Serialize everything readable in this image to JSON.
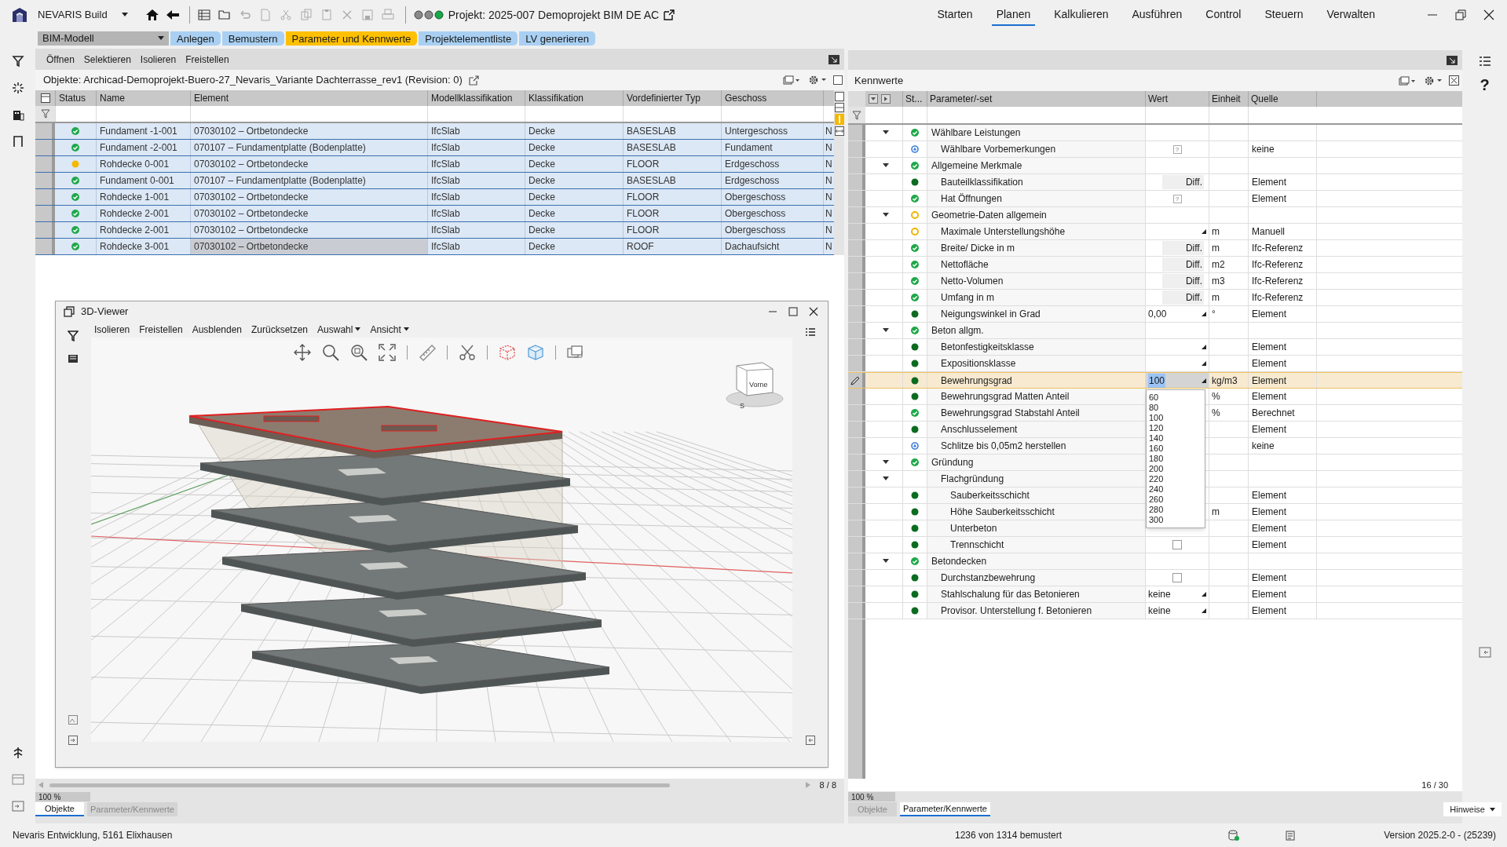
{
  "app": {
    "title": "NEVARIS Build",
    "project": "Projekt: 2025-007 Demoprojekt BIM DE AC"
  },
  "main_menu": [
    {
      "label": "Starten",
      "selected": false
    },
    {
      "label": "Planen",
      "selected": true
    },
    {
      "label": "Kalkulieren",
      "selected": false
    },
    {
      "label": "Ausführen",
      "selected": false
    },
    {
      "label": "Control",
      "selected": false
    },
    {
      "label": "Steuern",
      "selected": false
    },
    {
      "label": "Verwalten",
      "selected": false
    }
  ],
  "module_selector": "BIM-Modell",
  "steps": [
    {
      "label": "Anlegen",
      "selected": false
    },
    {
      "label": "Bemustern",
      "selected": false
    },
    {
      "label": "Parameter und Kennwerte",
      "selected": true
    },
    {
      "label": "Projektelementliste",
      "selected": false
    },
    {
      "label": "LV generieren",
      "selected": false
    }
  ],
  "objects_panel": {
    "toolbar": [
      "Öffnen",
      "Selektieren",
      "Isolieren",
      "Freistellen"
    ],
    "title": "Objekte: Archicad-Demoprojekt-Buero-27_Nevaris_Variante Dachterrasse_rev1 (Revision: 0)",
    "status_header": "Status",
    "columns": [
      "Name",
      "Element",
      "Modellklassifikation",
      "Klassifikation",
      "Vordefinierter Typ",
      "Geschoss"
    ],
    "rows": [
      {
        "status": {
          "kind": "check",
          "color": "#1fa84a"
        },
        "selected": true,
        "focused": false,
        "cells": [
          "Fundament -1-001",
          "07030102 – Ortbetondecke",
          "IfcSlab",
          "Decke",
          "BASESLAB",
          "Untergeschoss",
          "N"
        ]
      },
      {
        "status": {
          "kind": "check",
          "color": "#1fa84a"
        },
        "selected": true,
        "focused": false,
        "cells": [
          "Fundament -2-001",
          "070107 – Fundamentplatte (Bodenplatte)",
          "IfcSlab",
          "Decke",
          "BASESLAB",
          "Fundament",
          "N"
        ]
      },
      {
        "status": {
          "kind": "dot",
          "color": "#f5b800"
        },
        "selected": true,
        "focused": false,
        "cells": [
          "Rohdecke 0-001",
          "07030102 – Ortbetondecke",
          "IfcSlab",
          "Decke",
          "FLOOR",
          "Erdgeschoss",
          "N"
        ]
      },
      {
        "status": {
          "kind": "check",
          "color": "#1fa84a"
        },
        "selected": true,
        "focused": false,
        "cells": [
          "Fundament 0-001",
          "070107 – Fundamentplatte (Bodenplatte)",
          "IfcSlab",
          "Decke",
          "BASESLAB",
          "Erdgeschoss",
          "N"
        ]
      },
      {
        "status": {
          "kind": "check",
          "color": "#1fa84a"
        },
        "selected": true,
        "focused": false,
        "cells": [
          "Rohdecke 1-001",
          "07030102 – Ortbetondecke",
          "IfcSlab",
          "Decke",
          "FLOOR",
          "Obergeschoss",
          "N"
        ]
      },
      {
        "status": {
          "kind": "check",
          "color": "#1fa84a"
        },
        "selected": true,
        "focused": false,
        "cells": [
          "Rohdecke 2-001",
          "07030102 – Ortbetondecke",
          "IfcSlab",
          "Decke",
          "FLOOR",
          "Obergeschoss",
          "N"
        ]
      },
      {
        "status": {
          "kind": "check",
          "color": "#1fa84a"
        },
        "selected": true,
        "focused": false,
        "cells": [
          "Rohdecke 2-001",
          "07030102 – Ortbetondecke",
          "IfcSlab",
          "Decke",
          "FLOOR",
          "Obergeschoss",
          "N"
        ]
      },
      {
        "status": {
          "kind": "check",
          "color": "#1fa84a"
        },
        "selected": true,
        "focused": true,
        "cells": [
          "Rohdecke 3-001",
          "07030102 – Ortbetondecke",
          "IfcSlab",
          "Decke",
          "ROOF",
          "Dachaufsicht",
          "N"
        ]
      }
    ],
    "page": "8 / 8",
    "zoom": "100 %",
    "tabs": [
      {
        "label": "Objekte",
        "selected": true
      },
      {
        "label": "Parameter/Kennwerte",
        "selected": false
      }
    ]
  },
  "viewer": {
    "title": "3D-Viewer",
    "menu": [
      {
        "label": "Isolieren",
        "kind": "item"
      },
      {
        "label": "Freistellen",
        "kind": "item"
      },
      {
        "label": "Ausblenden",
        "kind": "item"
      },
      {
        "label": "Zurücksetzen",
        "kind": "item"
      },
      {
        "label": "Auswahl",
        "kind": "menu"
      },
      {
        "label": "Ansicht",
        "kind": "menu"
      }
    ],
    "cube": {
      "face": "Vorne",
      "compass": "S"
    }
  },
  "kennwerte": {
    "title": "Kennwerte",
    "columns": [
      "St...",
      "Parameter/-set",
      "Wert",
      "Einheit",
      "Quelle"
    ],
    "rows": [
      {
        "label": "Wählbare Leistungen",
        "status": {
          "kind": "check",
          "color": "#1fa84a"
        },
        "expanded": true,
        "selected": false,
        "children": [
          {
            "label": "Wählbare Vorbemerkungen",
            "status": {
              "kind": "ring_triangle",
              "color": "#3b7ddd"
            },
            "selected": false,
            "value": {
              "kind": "flag",
              "text": "?"
            },
            "source": "keine"
          }
        ]
      },
      {
        "label": "Allgemeine Merkmale",
        "status": {
          "kind": "check",
          "color": "#1fa84a"
        },
        "expanded": true,
        "selected": false,
        "children": [
          {
            "label": "Bauteilklassifikation",
            "status": {
              "kind": "dot",
              "color": "#0b6b1f"
            },
            "selected": false,
            "value": {
              "kind": "diff",
              "text": "Diff."
            },
            "source": "Element"
          },
          {
            "label": "Hat Öffnungen",
            "status": {
              "kind": "check",
              "color": "#1fa84a"
            },
            "selected": false,
            "value": {
              "kind": "flag",
              "text": "?"
            },
            "source": "Element"
          }
        ]
      },
      {
        "label": "Geometrie-Daten allgemein",
        "status": {
          "kind": "ring",
          "color": "#f2b400"
        },
        "expanded": true,
        "selected": false,
        "children": [
          {
            "label": "Maximale Unterstellungshöhe",
            "status": {
              "kind": "ring",
              "color": "#f2b400"
            },
            "selected": false,
            "value": {
              "kind": "dropdown"
            },
            "unit": "m",
            "source": "Manuell"
          },
          {
            "label": "Breite/ Dicke in m",
            "status": {
              "kind": "check",
              "color": "#1fa84a"
            },
            "selected": false,
            "value": {
              "kind": "diff",
              "text": "Diff."
            },
            "unit": "m",
            "source": "Ifc-Referenz"
          },
          {
            "label": "Nettofläche",
            "status": {
              "kind": "check",
              "color": "#1fa84a"
            },
            "selected": false,
            "value": {
              "kind": "diff",
              "text": "Diff."
            },
            "unit": "m2",
            "source": "Ifc-Referenz"
          },
          {
            "label": "Netto-Volumen",
            "status": {
              "kind": "check",
              "color": "#1fa84a"
            },
            "selected": false,
            "value": {
              "kind": "diff",
              "text": "Diff."
            },
            "unit": "m3",
            "source": "Ifc-Referenz"
          },
          {
            "label": "Umfang in m",
            "status": {
              "kind": "check",
              "color": "#1fa84a"
            },
            "selected": false,
            "value": {
              "kind": "diff",
              "text": "Diff."
            },
            "unit": "m",
            "source": "Ifc-Referenz"
          },
          {
            "label": "Neigungswinkel in Grad",
            "status": {
              "kind": "dot",
              "color": "#0b6b1f"
            },
            "selected": false,
            "value": {
              "kind": "dropdown",
              "text": "0,00"
            },
            "unit": "°",
            "source": "Element"
          }
        ]
      },
      {
        "label": "Beton allgm.",
        "status": {
          "kind": "check",
          "color": "#1fa84a"
        },
        "expanded": true,
        "selected": false,
        "children": [
          {
            "label": "Betonfestigkeitsklasse",
            "status": {
              "kind": "dot",
              "color": "#0b6b1f"
            },
            "selected": false,
            "value": {
              "kind": "dropdown"
            },
            "source": "Element"
          },
          {
            "label": "Expositionsklasse",
            "status": {
              "kind": "dot",
              "color": "#0b6b1f"
            },
            "selected": false,
            "value": {
              "kind": "dropdown"
            },
            "source": "Element"
          },
          {
            "label": "Bewehrungsgrad",
            "status": {
              "kind": "dot",
              "color": "#0b6b1f"
            },
            "selected": true,
            "value": {
              "kind": "dropdown",
              "text": "100",
              "open": true,
              "options": [
                "60",
                "80",
                "100",
                "120",
                "140",
                "160",
                "180",
                "200",
                "220",
                "240",
                "260",
                "280",
                "300"
              ]
            },
            "unit": "kg/m3",
            "source": "Element"
          },
          {
            "label": "Bewehrungsgrad Matten Anteil",
            "status": {
              "kind": "dot",
              "color": "#0b6b1f"
            },
            "selected": false,
            "unit": "%",
            "source": "Element"
          },
          {
            "label": "Bewehrungsgrad Stabstahl Anteil",
            "status": {
              "kind": "check",
              "color": "#1fa84a"
            },
            "selected": false,
            "unit": "%",
            "source": "Berechnet"
          },
          {
            "label": "Anschlusselement",
            "status": {
              "kind": "dot",
              "color": "#0b6b1f"
            },
            "selected": false,
            "source": "Element"
          },
          {
            "label": "Schlitze bis 0,05m2 herstellen",
            "status": {
              "kind": "ring_triangle",
              "color": "#3b7ddd"
            },
            "selected": false,
            "source": "keine"
          }
        ]
      },
      {
        "label": "Gründung",
        "status": {
          "kind": "check",
          "color": "#1fa84a"
        },
        "expanded": true,
        "selected": false,
        "children": [
          {
            "label": "Flachgründung",
            "expanded": true,
            "selected": false,
            "children": [
              {
                "label": "Sauberkeitsschicht",
                "status": {
                  "kind": "dot",
                  "color": "#0b6b1f"
                },
                "selected": false,
                "source": "Element"
              },
              {
                "label": "Höhe Sauberkeitsschicht",
                "status": {
                  "kind": "dot",
                  "color": "#0b6b1f"
                },
                "selected": false,
                "unit": "m",
                "source": "Element"
              },
              {
                "label": "Unterbeton",
                "status": {
                  "kind": "dot",
                  "color": "#0b6b1f"
                },
                "selected": false,
                "source": "Element"
              },
              {
                "label": "Trennschicht",
                "status": {
                  "kind": "dot",
                  "color": "#0b6b1f"
                },
                "selected": false,
                "value": {
                  "kind": "checkbox",
                  "checked": false
                },
                "source": "Element"
              }
            ]
          }
        ]
      },
      {
        "label": "Betondecken",
        "status": {
          "kind": "check",
          "color": "#1fa84a"
        },
        "expanded": true,
        "selected": false,
        "children": [
          {
            "label": "Durchstanzbewehrung",
            "status": {
              "kind": "dot",
              "color": "#0b6b1f"
            },
            "selected": false,
            "value": {
              "kind": "checkbox",
              "checked": false
            },
            "source": "Element"
          },
          {
            "label": "Stahlschalung für das Betonieren",
            "status": {
              "kind": "dot",
              "color": "#0b6b1f"
            },
            "selected": false,
            "value": {
              "kind": "dropdown",
              "text": "keine"
            },
            "source": "Element"
          },
          {
            "label": "Provisor. Unterstellung f. Betonieren",
            "status": {
              "kind": "dot",
              "color": "#0b6b1f"
            },
            "selected": false,
            "value": {
              "kind": "dropdown",
              "text": "keine"
            },
            "source": "Element"
          }
        ]
      }
    ],
    "count": "16 / 30",
    "zoom": "100 %",
    "tabs": [
      {
        "label": "Objekte",
        "selected": false
      },
      {
        "label": "Parameter/Kennwerte",
        "selected": true
      }
    ],
    "notes_menu": "Hinweise"
  },
  "help": "?",
  "status_bar": {
    "company": "Nevaris Entwicklung, 5161 Elixhausen",
    "progress": "1236 von 1314 bemustert",
    "version": "Version 2025.2-0 - (25239)"
  }
}
